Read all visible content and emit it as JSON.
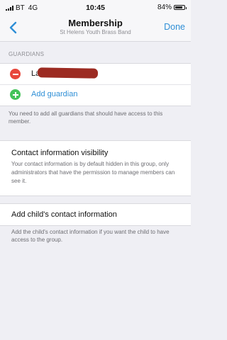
{
  "status": {
    "carrier": "BT",
    "network": "4G",
    "time": "10:45",
    "battery_percent": "84%",
    "battery_level": 0.84
  },
  "nav": {
    "title": "Membership",
    "subtitle": "St Helens Youth Brass Band",
    "done_label": "Done"
  },
  "guardians": {
    "header": "GUARDIANS",
    "items": [
      {
        "name_visible": "La"
      }
    ],
    "add_label": "Add guardian",
    "helper": "You need to add all guardians that should have access to this member."
  },
  "visibility": {
    "title": "Contact information visibility",
    "body": "Your contact information is by default hidden in this group, only administrators that have the permission to manage members can see it."
  },
  "child_contact": {
    "title": "Add child's contact information",
    "helper": "Add the child's contact information if you want the child to have access to the group."
  },
  "colors": {
    "accent": "#2f8fd6",
    "remove": "#e8463b",
    "add": "#44c35a",
    "background": "#efeff4"
  }
}
